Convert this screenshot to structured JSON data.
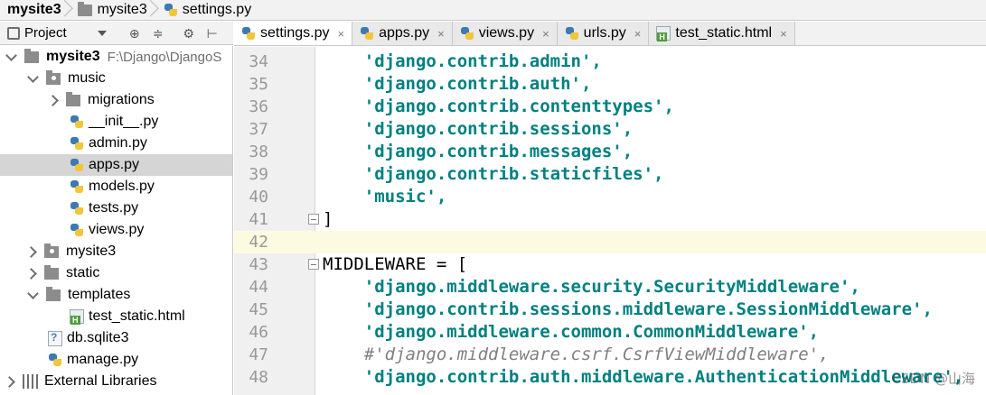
{
  "breadcrumb": [
    "mysite3",
    "mysite3",
    "settings.py"
  ],
  "project_panel": {
    "label": "Project"
  },
  "tree": [
    {
      "label": "mysite3",
      "path": "F:\\Django\\DjangoS",
      "level": 0,
      "expanded": true,
      "kind": "folder"
    },
    {
      "label": "music",
      "level": 1,
      "expanded": true,
      "kind": "folder"
    },
    {
      "label": "migrations",
      "level": 2,
      "expanded": false,
      "kind": "folder"
    },
    {
      "label": "__init__.py",
      "level": 2,
      "kind": "py"
    },
    {
      "label": "admin.py",
      "level": 2,
      "kind": "py"
    },
    {
      "label": "apps.py",
      "level": 2,
      "kind": "py",
      "selected": true
    },
    {
      "label": "models.py",
      "level": 2,
      "kind": "py"
    },
    {
      "label": "tests.py",
      "level": 2,
      "kind": "py"
    },
    {
      "label": "views.py",
      "level": 2,
      "kind": "py"
    },
    {
      "label": "mysite3",
      "level": 1,
      "expanded": false,
      "kind": "folder"
    },
    {
      "label": "static",
      "level": 1,
      "expanded": false,
      "kind": "folder"
    },
    {
      "label": "templates",
      "level": 1,
      "expanded": true,
      "kind": "folder"
    },
    {
      "label": "test_static.html",
      "level": 2,
      "kind": "html"
    },
    {
      "label": "db.sqlite3",
      "level": 1,
      "kind": "db"
    },
    {
      "label": "manage.py",
      "level": 1,
      "kind": "py"
    },
    {
      "label": "External Libraries",
      "level": 0,
      "expanded": false,
      "kind": "lib"
    }
  ],
  "tabs": [
    {
      "label": "settings.py",
      "kind": "py",
      "active": true
    },
    {
      "label": "apps.py",
      "kind": "py"
    },
    {
      "label": "views.py",
      "kind": "py"
    },
    {
      "label": "urls.py",
      "kind": "py"
    },
    {
      "label": "test_static.html",
      "kind": "html"
    }
  ],
  "tab_close": "×",
  "code": [
    {
      "n": "34",
      "t": "    'django.contrib.admin',",
      "kind": "str"
    },
    {
      "n": "35",
      "t": "    'django.contrib.auth',",
      "kind": "str"
    },
    {
      "n": "36",
      "t": "    'django.contrib.contenttypes',",
      "kind": "str"
    },
    {
      "n": "37",
      "t": "    'django.contrib.sessions',",
      "kind": "str"
    },
    {
      "n": "38",
      "t": "    'django.contrib.messages',",
      "kind": "str"
    },
    {
      "n": "39",
      "t": "    'django.contrib.staticfiles',",
      "kind": "str"
    },
    {
      "n": "40",
      "t": "    'music',",
      "kind": "str"
    },
    {
      "n": "41",
      "t": "]",
      "kind": "plain",
      "fold": true
    },
    {
      "n": "42",
      "t": "",
      "kind": "plain",
      "highlight": true
    },
    {
      "n": "43",
      "t": "MIDDLEWARE = [",
      "kind": "plain",
      "fold": true
    },
    {
      "n": "44",
      "t": "    'django.middleware.security.SecurityMiddleware',",
      "kind": "str"
    },
    {
      "n": "45",
      "t": "    'django.contrib.sessions.middleware.SessionMiddleware',",
      "kind": "str"
    },
    {
      "n": "46",
      "t": "    'django.middleware.common.CommonMiddleware',",
      "kind": "str"
    },
    {
      "n": "47",
      "t": "    #'django.middleware.csrf.CsrfViewMiddleware',",
      "kind": "comment"
    },
    {
      "n": "48",
      "t": "    'django.contrib.auth.middleware.AuthenticationMiddleware',",
      "kind": "str"
    }
  ],
  "watermark": "CSDN @山海"
}
